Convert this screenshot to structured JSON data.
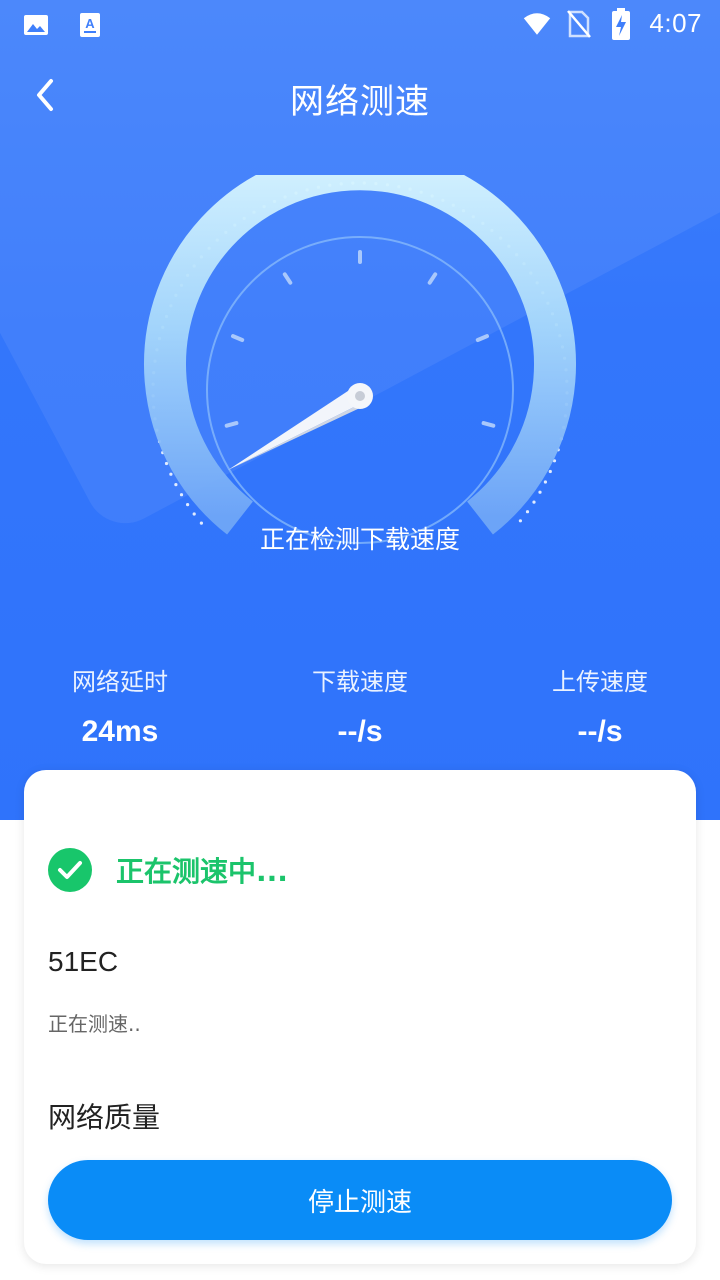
{
  "status_bar": {
    "time": "4:07",
    "left_icons": [
      "image-icon",
      "text-a-icon"
    ],
    "right_icons": [
      "wifi-icon",
      "no-sim-icon",
      "battery-charging-icon"
    ]
  },
  "header": {
    "title": "网络测速",
    "back_icon": "chevron-left-icon"
  },
  "gauge": {
    "status_text": "正在检测下载速度",
    "needle_fraction": 0.0
  },
  "stats": [
    {
      "label": "网络延时",
      "value": "24ms"
    },
    {
      "label": "下载速度",
      "value": "--/s"
    },
    {
      "label": "上传速度",
      "value": "--/s"
    }
  ],
  "card": {
    "status_text": "正在测速中...",
    "network_name": "51EC",
    "network_sub": "正在测速..",
    "quality_title": "网络质量",
    "stop_button_label": "停止测速"
  },
  "colors": {
    "primary_blue": "#3376fb",
    "success_green": "#1bc46b",
    "button_blue": "#0a8cf7"
  }
}
